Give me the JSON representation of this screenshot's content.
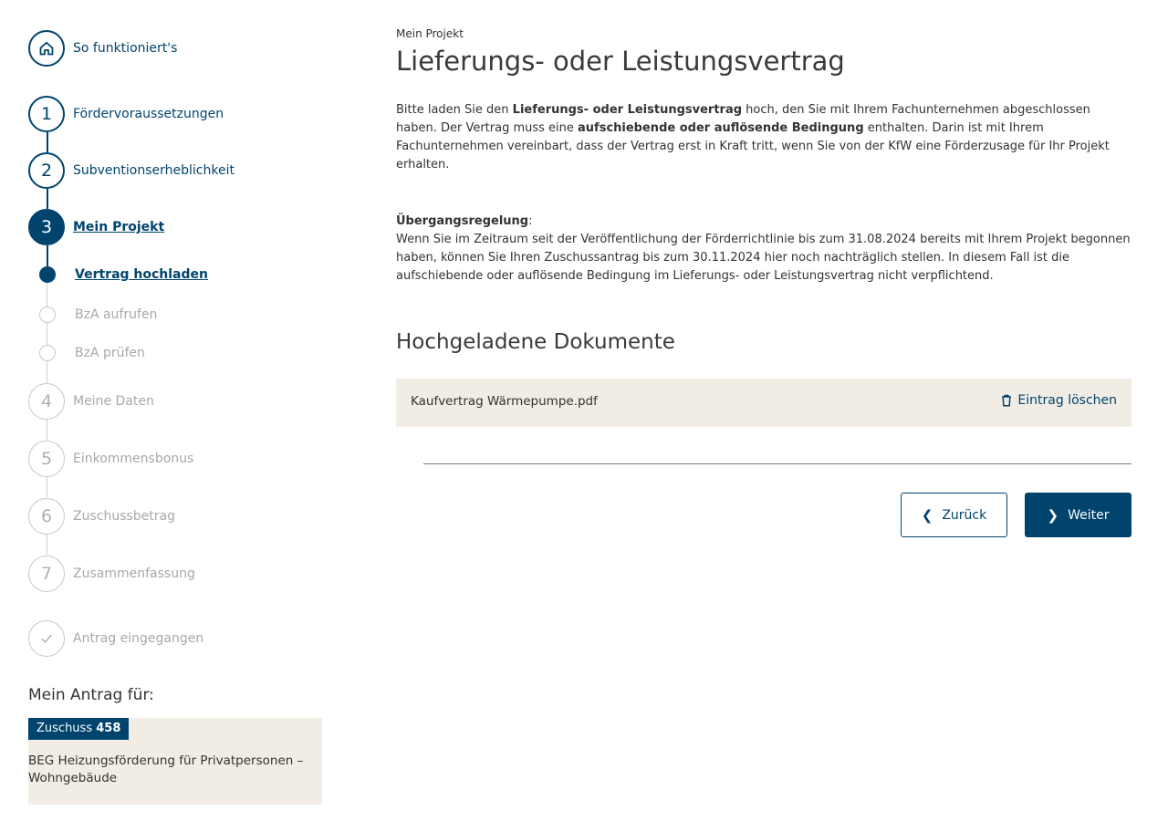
{
  "sidebar": {
    "home": {
      "label": "So funktioniert's"
    },
    "steps": [
      {
        "number": "1",
        "label": "Fördervoraussetzungen"
      },
      {
        "number": "2",
        "label": "Subventionserheblichkeit"
      },
      {
        "number": "3",
        "label": "Mein Projekt"
      },
      {
        "number": "4",
        "label": "Meine Daten"
      },
      {
        "number": "5",
        "label": "Einkommensbonus"
      },
      {
        "number": "6",
        "label": "Zuschussbetrag"
      },
      {
        "number": "7",
        "label": "Zusammenfassung"
      }
    ],
    "substeps": [
      {
        "label": "Vertrag hochladen"
      },
      {
        "label": "BzA aufrufen"
      },
      {
        "label": "BzA prüfen"
      }
    ],
    "final_step": {
      "label": "Antrag eingegangen"
    },
    "summary": {
      "heading": "Mein Antrag für:",
      "badge_prefix": "Zuschuss",
      "badge_number": "458",
      "description": "BEG Heizungsförderung für Privatpersonen – Wohngebäude"
    }
  },
  "main": {
    "pre_title": "Mein Projekt",
    "title": "Lieferungs- oder Leistungsvertrag",
    "intro": {
      "t1": "Bitte laden Sie den ",
      "b1": "Lieferungs- oder Leistungsvertrag",
      "t2": " hoch, den Sie mit Ihrem Fachunternehmen abgeschlossen haben. Der Vertrag muss eine ",
      "b2": "aufschiebende oder auflösende Bedingung",
      "t3": " enthalten. Darin ist mit Ihrem Fachunternehmen vereinbart, dass der Vertrag erst in Kraft tritt, wenn Sie von der KfW eine Förderzusage für Ihr Projekt erhalten."
    },
    "transition": {
      "heading": "Übergangsregelung",
      "colon": ":",
      "text": "Wenn Sie im Zeitraum seit der Veröffentlichung der Förderrichtlinie bis zum 31.08.2024 bereits mit Ihrem Projekt begonnen haben, können Sie Ihren Zuschussantrag bis zum 30.11.2024 hier noch nachträglich stellen. In diesem Fall ist die aufschiebende oder auflösende Bedingung im Lieferungs- oder Leistungsvertrag nicht verpflichtend."
    },
    "documents": {
      "heading": "Hochgeladene Dokumente",
      "items": [
        {
          "name": "Kaufvertrag Wärmepumpe.pdf",
          "delete_label": "Eintrag löschen"
        }
      ]
    },
    "buttons": {
      "back": "Zurück",
      "next": "Weiter"
    }
  },
  "colors": {
    "primary": "#00446e",
    "surface": "#f1ede4",
    "muted": "#a8a8a8"
  }
}
